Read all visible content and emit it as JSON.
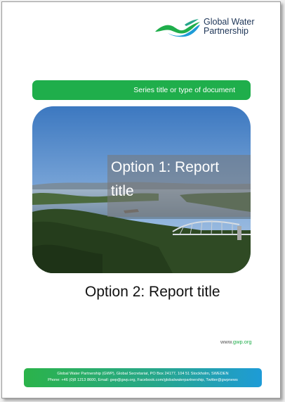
{
  "logo": {
    "line1": "Global Water",
    "line2": "Partnership"
  },
  "series_banner": {
    "text": "Series title or type of document"
  },
  "photo": {
    "overlay_title": "Option 1: Report\ntitle"
  },
  "report_title": "Option 2: Report title",
  "website": {
    "prefix": "www.",
    "accent": "gwp.org"
  },
  "footer": {
    "line1": "Global Water Partnership (GWP), Global Secretariat, PO Box 24177, 104 51 Stockholm, SWEDEN",
    "line2": "Phone: +46 (0)8 1213 8600, Email: gwp@gwp.org, Facebook.com/globalwaterpartnership, Twitter@gwpnews"
  },
  "colors": {
    "brand_green": "#1fae4b",
    "brand_blue": "#1e9bd7",
    "logo_text": "#1d3557"
  }
}
